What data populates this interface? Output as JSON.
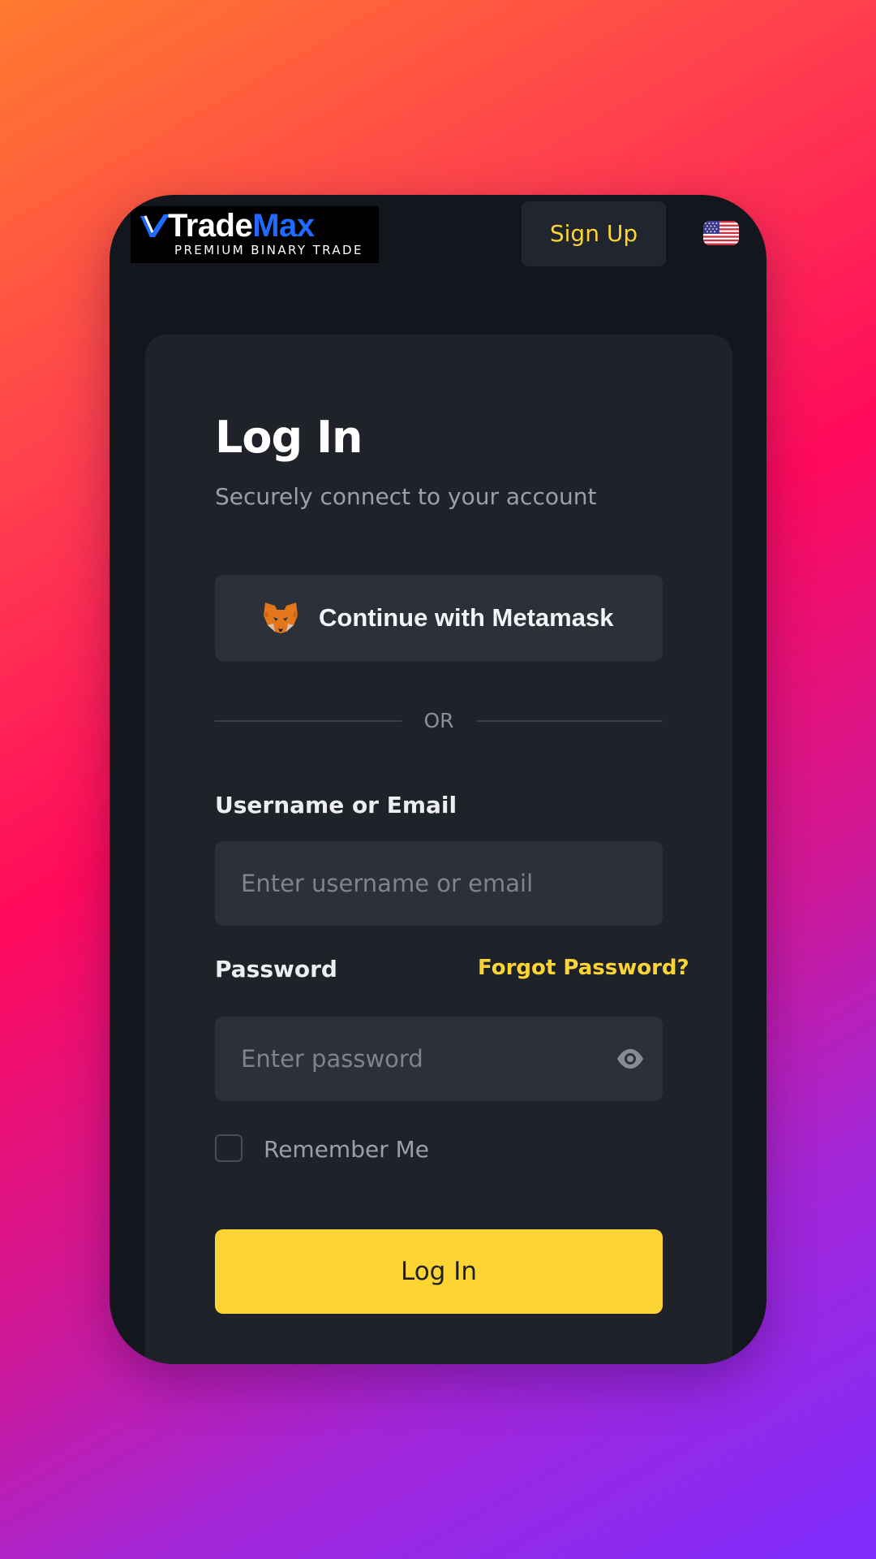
{
  "header": {
    "logo": {
      "name_part1": "Trade",
      "name_part2": "Max",
      "tagline": "PREMIUM BINARY TRADE"
    },
    "signup_label": "Sign Up",
    "language_icon": "us-flag-icon"
  },
  "login": {
    "title": "Log In",
    "subtitle": "Securely connect to your account",
    "metamask_label": "Continue with Metamask",
    "metamask_icon": "metamask-fox-icon",
    "divider_text": "OR",
    "username_label": "Username or Email",
    "username_placeholder": "Enter username or email",
    "username_value": "",
    "password_label": "Password",
    "forgot_label": "Forgot Password?",
    "password_placeholder": "Enter password",
    "password_value": "",
    "password_toggle_icon": "eye-icon",
    "remember_label": "Remember Me",
    "remember_checked": false,
    "submit_label": "Log In"
  },
  "colors": {
    "accent": "#fcd535",
    "background": "#13161d",
    "card": "#1f2229",
    "input": "#2b3039",
    "logo_accent": "#1f6bff"
  }
}
